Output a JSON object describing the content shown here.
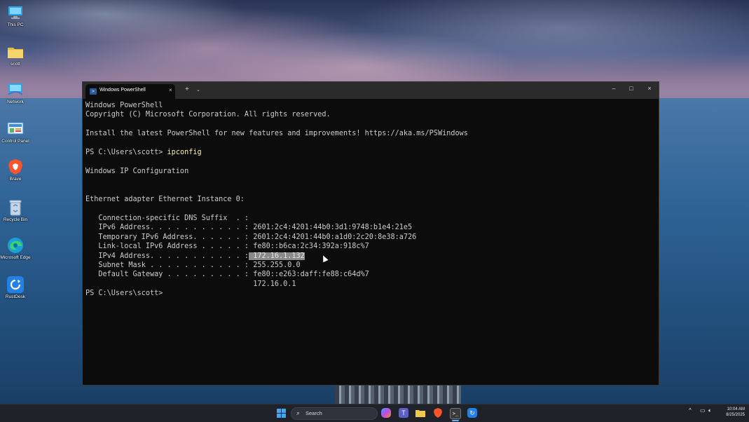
{
  "desktop": {
    "icons": [
      {
        "label": "This PC",
        "icon": "monitor-icon",
        "color": "#2aa4e8"
      },
      {
        "label": "scott",
        "icon": "folder-icon",
        "color": "#f2c84b"
      },
      {
        "label": "Network",
        "icon": "network-icon",
        "color": "#2aa4e8"
      },
      {
        "label": "Control Panel",
        "icon": "control-panel-icon",
        "color": "#3a8fd6"
      },
      {
        "label": "Brave",
        "icon": "brave-icon",
        "color": "#fb542b"
      },
      {
        "label": "Recycle Bin",
        "icon": "recycle-bin-icon",
        "color": "#cfd8e6"
      },
      {
        "label": "Microsoft Edge",
        "icon": "edge-icon",
        "color": "#1aa0d8"
      },
      {
        "label": "RustDesk",
        "icon": "rustdesk-icon",
        "color": "#2480e6"
      }
    ]
  },
  "terminal": {
    "tab_title": "Windows PowerShell",
    "tab_close": "×",
    "new_tab": "+",
    "dropdown": "⌄",
    "minimize": "–",
    "maximize": "□",
    "close": "×",
    "lines": {
      "l1": "Windows PowerShell",
      "l2": "Copyright (C) Microsoft Corporation. All rights reserved.",
      "l3": "Install the latest PowerShell for new features and improvements! https://aka.ms/PSWindows",
      "prompt1": "PS C:\\Users\\scott> ",
      "cmd": "ipconfig",
      "l5": "Windows IP Configuration",
      "l6": "Ethernet adapter Ethernet Instance 0:",
      "dns": "   Connection-specific DNS Suffix  . :",
      "ipv6": "   IPv6 Address. . . . . . . . . . . : 2601:2c4:4201:44b0:3d1:9748:b1e4:21e5",
      "tmp_ipv6": "   Temporary IPv6 Address. . . . . . : 2601:2c4:4201:44b0:a1d0:2c20:8e38:a726",
      "ll_ipv6": "   Link-local IPv6 Address . . . . . : fe80::b6ca:2c34:392a:918c%7",
      "ipv4_label": "   IPv4 Address. . . . . . . . . . . :",
      "ipv4_value": " 172.16.1.132",
      "mask": "   Subnet Mask . . . . . . . . . . . : 255.255.0.0",
      "gw1": "   Default Gateway . . . . . . . . . : fe80::e263:daff:fe88:c64d%7",
      "gw2": "                                       172.16.0.1",
      "prompt2": "PS C:\\Users\\scott>"
    }
  },
  "taskbar": {
    "search_placeholder": "Search",
    "time": "10:04 AM",
    "date": "8/25/2025",
    "tray_chevron": "^",
    "apps": [
      {
        "icon": "windows-start-icon",
        "color": "#3ea8f0"
      },
      {
        "icon": "copilot-icon",
        "color": "#8a6be8"
      },
      {
        "icon": "teams-icon",
        "color": "#5b5fc7"
      },
      {
        "icon": "file-explorer-icon",
        "color": "#f2c84b"
      },
      {
        "icon": "brave-icon",
        "color": "#fb542b"
      },
      {
        "icon": "terminal-icon",
        "color": "#3a3a3a"
      },
      {
        "icon": "rustdesk-icon",
        "color": "#2480e6"
      }
    ]
  }
}
